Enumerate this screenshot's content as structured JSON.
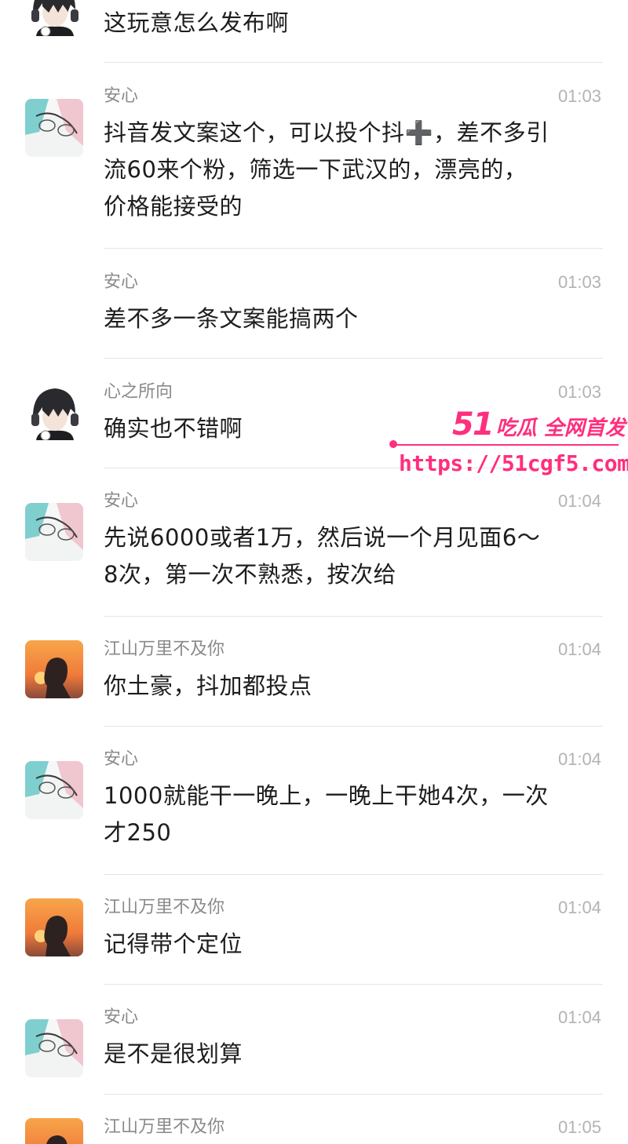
{
  "messages": [
    {
      "avatar": "anime-boy-headphones",
      "name": "",
      "time": "",
      "text": "这玩意怎么发布啊"
    },
    {
      "avatar": "anxin-glasses",
      "name": "安心",
      "time": "01:03",
      "text": "抖音发文案这个，可以投个抖➕，差不多引\n流60来个粉，筛选一下武汉的，漂亮的，\n价格能接受的"
    },
    {
      "avatar": "anxin-glasses",
      "name": "安心",
      "time": "01:03",
      "text": "差不多一条文案能搞两个"
    },
    {
      "avatar": "anime-boy-headphones",
      "name": "心之所向",
      "time": "01:03",
      "text": "确实也不错啊"
    },
    {
      "avatar": "anxin-glasses",
      "name": "安心",
      "time": "01:04",
      "text": "先说6000或者1万，然后说一个月见面6～\n8次，第一次不熟悉，按次给"
    },
    {
      "avatar": "sunset-silhouette",
      "name": "江山万里不及你",
      "time": "01:04",
      "text": "你土豪，抖加都投点"
    },
    {
      "avatar": "anxin-glasses",
      "name": "安心",
      "time": "01:04",
      "text": "1000就能干一晚上，一晚上干她4次，一次\n才250"
    },
    {
      "avatar": "sunset-silhouette",
      "name": "江山万里不及你",
      "time": "01:04",
      "text": "记得带个定位"
    },
    {
      "avatar": "anxin-glasses",
      "name": "安心",
      "time": "01:04",
      "text": "是不是很划算"
    },
    {
      "avatar": "sunset-silhouette",
      "name": "江山万里不及你",
      "time": "01:05",
      "text": ""
    }
  ],
  "watermark": {
    "number": "51",
    "label": "吃瓜 全网首发",
    "url": "https://51cgf5.com"
  },
  "colors": {
    "name_gray": "#8a8a8a",
    "time_gray": "#b3b3b3",
    "divider": "#e6e6e6",
    "watermark_pink": "#ff2e7e"
  }
}
